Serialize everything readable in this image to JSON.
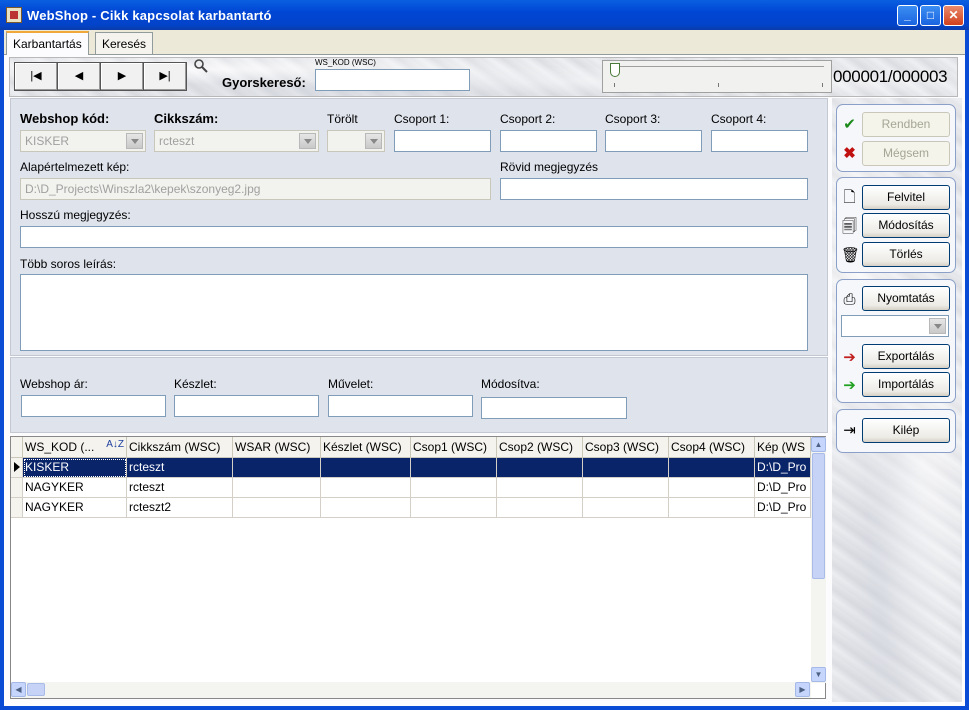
{
  "window": {
    "title": "WebShop - Cikk kapcsolat karbantartó",
    "controls": {
      "minimize": "_",
      "maximize": "□",
      "close": "✕"
    }
  },
  "tabs": [
    {
      "label": "Karbantartás",
      "active": true
    },
    {
      "label": "Keresés",
      "active": false
    }
  ],
  "toolbar": {
    "nav": {
      "first": "|◀",
      "prev": "◀",
      "next": "▶",
      "last": "▶|"
    },
    "quick_search_label": "Gyorskereső:",
    "field_caption": "WS_KOD (WSC)",
    "quick_search_value": "",
    "record_counter": "000001/000003",
    "slider_position": 0
  },
  "form": {
    "webshop_kod": {
      "label": "Webshop kód:",
      "value": "KISKER"
    },
    "cikkszam": {
      "label": "Cikkszám:",
      "value": "rcteszt"
    },
    "torolt": {
      "label": "Törölt",
      "value": ""
    },
    "csoport1": {
      "label": "Csoport 1:",
      "value": ""
    },
    "csoport2": {
      "label": "Csoport 2:",
      "value": ""
    },
    "csoport3": {
      "label": "Csoport 3:",
      "value": ""
    },
    "csoport4": {
      "label": "Csoport 4:",
      "value": ""
    },
    "alap_kep": {
      "label": "Alapértelmezett kép:",
      "value": "D:\\D_Projects\\Winszla2\\kepek\\szonyeg2.jpg"
    },
    "rovid": {
      "label": "Rövid megjegyzés",
      "value": ""
    },
    "hosszu": {
      "label": "Hosszú megjegyzés:",
      "value": ""
    },
    "tobb_soros": {
      "label": "Több soros leírás:",
      "value": ""
    },
    "webshop_ar": {
      "label": "Webshop ár:",
      "value": ""
    },
    "keszlet": {
      "label": "Készlet:",
      "value": ""
    },
    "muvelet": {
      "label": "Művelet:",
      "value": ""
    },
    "modositva": {
      "label": "Módosítva:",
      "value": ""
    }
  },
  "grid": {
    "columns": [
      "WS_KOD (...",
      "Cikkszám (WSC)",
      "WSAR (WSC)",
      "Készlet (WSC)",
      "Csop1 (WSC)",
      "Csop2 (WSC)",
      "Csop3 (WSC)",
      "Csop4 (WSC)",
      "Kép (WS"
    ],
    "sort_indicator": "A↓Z",
    "rows": [
      [
        "KISKER",
        "rcteszt",
        "",
        "",
        "",
        "",
        "",
        "",
        "D:\\D_Pro"
      ],
      [
        "NAGYKER",
        "rcteszt",
        "",
        "",
        "",
        "",
        "",
        "",
        "D:\\D_Pro"
      ],
      [
        "NAGYKER",
        "rcteszt2",
        "",
        "",
        "",
        "",
        "",
        "",
        "D:\\D_Pro"
      ]
    ],
    "selected_row": 0
  },
  "actions": {
    "rendben": "Rendben",
    "megsem": "Mégsem",
    "felvitel": "Felvitel",
    "modositas": "Módosítás",
    "torles": "Törlés",
    "nyomtatas": "Nyomtatás",
    "print_option": "",
    "exportalas": "Exportálás",
    "importalas": "Importálás",
    "kilep": "Kilép"
  },
  "colors": {
    "title_bar": "#0046d5",
    "selection": "#0a246a",
    "panel": "#dfe3ec"
  }
}
